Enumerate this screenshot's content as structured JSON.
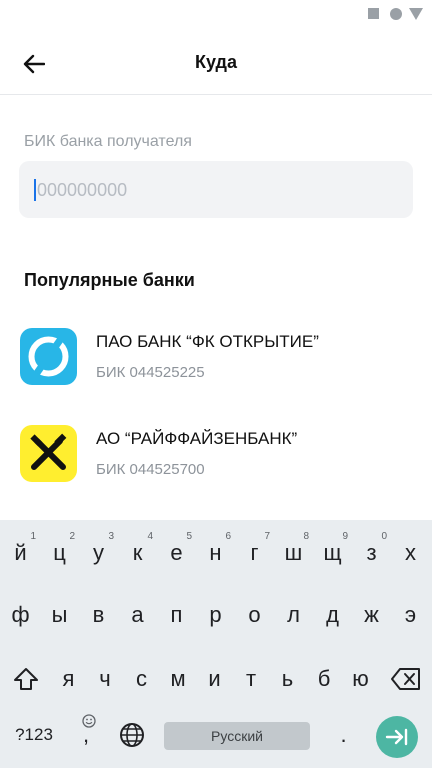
{
  "header": {
    "title": "Куда",
    "back_icon": "arrow-left-icon"
  },
  "bik_field": {
    "label": "БИК банка получателя",
    "placeholder": "000000000",
    "value": ""
  },
  "popular": {
    "title": "Популярные банки",
    "banks": [
      {
        "name": "ПАО БАНК “ФК ОТКРЫТИЕ”",
        "bik": "БИК 044525225",
        "logo": "otkritie-logo",
        "logo_color": "#28b6e7"
      },
      {
        "name": "АО “РАЙФФАЙЗЕНБАНК”",
        "bik": "БИК 044525700",
        "logo": "raiffeisen-logo",
        "logo_color": "#ffee2f"
      }
    ]
  },
  "keyboard": {
    "row1": [
      {
        "key": "й",
        "hint": "1"
      },
      {
        "key": "ц",
        "hint": "2"
      },
      {
        "key": "у",
        "hint": "3"
      },
      {
        "key": "к",
        "hint": "4"
      },
      {
        "key": "е",
        "hint": "5"
      },
      {
        "key": "н",
        "hint": "6"
      },
      {
        "key": "г",
        "hint": "7"
      },
      {
        "key": "ш",
        "hint": "8"
      },
      {
        "key": "щ",
        "hint": "9"
      },
      {
        "key": "з",
        "hint": "0"
      },
      {
        "key": "х",
        "hint": ""
      }
    ],
    "row2": [
      "ф",
      "ы",
      "в",
      "а",
      "п",
      "р",
      "о",
      "л",
      "д",
      "ж",
      "э"
    ],
    "row3": [
      "я",
      "ч",
      "с",
      "м",
      "и",
      "т",
      "ь",
      "б",
      "ю"
    ],
    "num_label": "?123",
    "comma": ",",
    "space_label": "Русский",
    "period": ".",
    "background": "#e9edf0",
    "enter_color": "#4db6a3"
  }
}
